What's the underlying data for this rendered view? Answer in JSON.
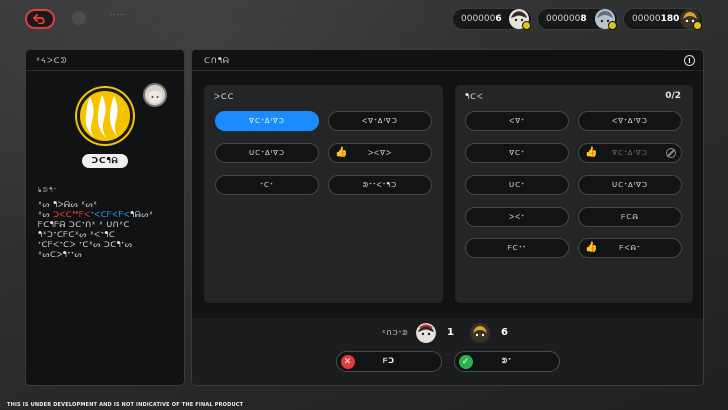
{
  "top_bar": {
    "title": "ᐧᐧᐧᐧᐧ",
    "counters": [
      {
        "value": "000000",
        "bold": "6",
        "icon": "character-a-icon",
        "color": "#c7332f"
      },
      {
        "value": "000000",
        "bold": "8",
        "icon": "character-b-icon",
        "color": "#7a8fa2"
      },
      {
        "value": "00000",
        "bold": "180",
        "icon": "character-c-icon",
        "color": "#d9a531"
      }
    ]
  },
  "profile": {
    "header": "ᕁᔦᐳᑕᕲ",
    "name": "ᑐᑕᖳᕱ",
    "description_label": "ᖲᕲᖳᐩ",
    "description": {
      "line1": "ᕽᔕ ᖳᐳᕱᔕ ᕽᔕᕽ",
      "line2_a": "ᕽᔕ ",
      "line2_red": "ᑐᐸᑕᕯᖴᐸ",
      "line2_blue": "ᐩᐸᑕᖴᐸᖴᐸ",
      "line2_b": "ᖳᕱᔕᕽ",
      "line3": "ᖴᑕᖳᖴᕱ ᑐᑕᐩᑎᕽ ᕽ ᑌᑎᕽᑕ",
      "line4": "ᖳᕽᑐᐩᑕᖴᑕᕽᔕ ᕽᐸᐩᖳᑕ",
      "line5": "ᐩᑕᖴᐸᐩᑕᐳ ᐩᑕᕽᔕ ᑐᑕᖳᐩᔕ",
      "line6": "ᕽᔕᑕᐳᖳᐩᐩᔕ"
    }
  },
  "main": {
    "header": "ᑕᑎᖳᕱ",
    "left_group": {
      "title": "ᐳᑕᑕ",
      "options": [
        {
          "label": "ᐁᑕᐩᐃᑊᐁᑐ",
          "state": "selected",
          "icon": ""
        },
        {
          "label": "ᐸᐁᐩᐃᑊᐁᑐ",
          "state": "normal",
          "icon": ""
        },
        {
          "label": "ᑌᑕᐩᐃᑊᐁᑐ",
          "state": "normal",
          "icon": ""
        },
        {
          "label": "ᐳᐸᐁᐳ",
          "state": "normal",
          "icon": "thumbs-up-emoji-icon",
          "emoji": "👍"
        },
        {
          "label": "ᐩᑕᐩ",
          "state": "normal",
          "icon": ""
        },
        {
          "label": "ᕲᐩᐩᐸᐩᖳᑐ",
          "state": "normal",
          "icon": ""
        }
      ]
    },
    "right_group": {
      "title": "ᖳᑕᐸ",
      "count": "0/2",
      "options": [
        {
          "label": "ᐸᐁᐩ",
          "state": "normal",
          "icon": ""
        },
        {
          "label": "ᐸᐁᐩᐃᑊᐁᑐ",
          "state": "normal",
          "icon": ""
        },
        {
          "label": "ᐁᑕᐩ",
          "state": "normal",
          "icon": ""
        },
        {
          "label": "ᐁᑕᐩᐃᑊᐁᑐ",
          "state": "disabled",
          "icon": "thumbs-up-emoji-icon",
          "emoji": "👍",
          "blocked": true
        },
        {
          "label": "ᑌᑕᐩ",
          "state": "normal",
          "icon": ""
        },
        {
          "label": "ᑌᑕᐩᐃᑊᐁᑐ",
          "state": "normal",
          "icon": ""
        },
        {
          "label": "ᐳᐸᐩ",
          "state": "normal",
          "icon": ""
        },
        {
          "label": "ᖴᑕᕱ",
          "state": "normal",
          "icon": ""
        },
        {
          "label": "ᖴᑕᐩᐩ",
          "state": "normal",
          "icon": ""
        },
        {
          "label": "ᖴᐸᕱᐩ",
          "state": "normal",
          "icon": "thumbs-up-emoji-icon",
          "emoji": "👍"
        }
      ]
    },
    "summary": {
      "label": "ᕽᑎᑐᐩᕲ",
      "items": [
        {
          "count": "1",
          "icon": "character-a-icon"
        },
        {
          "count": "6",
          "icon": "character-c-icon"
        }
      ]
    },
    "buttons": {
      "cancel_label": "ᖴᑐ",
      "confirm_label": "ᕲᐩ",
      "cancel_color": "#e23b3b",
      "confirm_color": "#2bb24c"
    }
  },
  "footer": {
    "note": "THIS IS UNDER DEVELOPMENT AND IS NOT INDICATIVE OF THE FINAL PRODUCT"
  }
}
